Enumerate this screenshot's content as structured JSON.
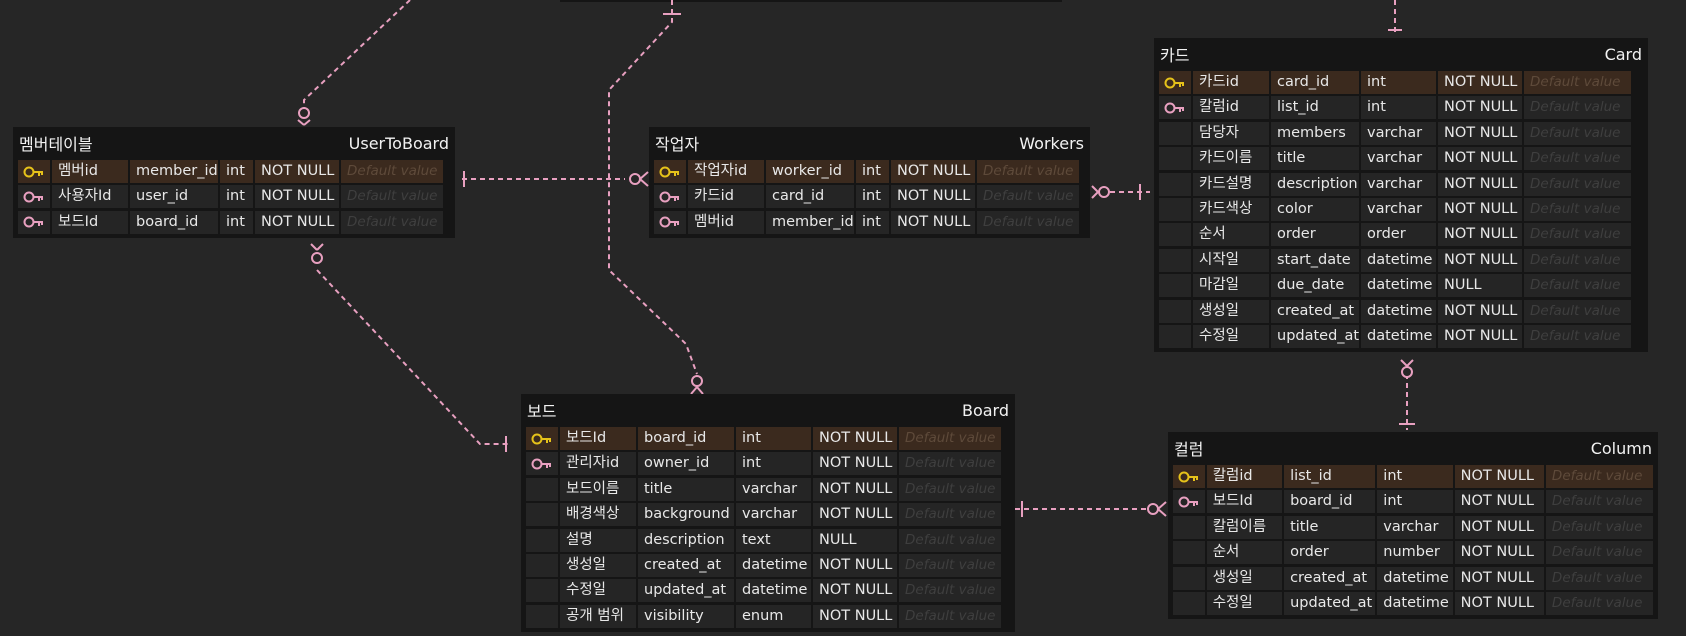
{
  "colors": {
    "background": "#262626",
    "table_bg": "#151515",
    "cell_bg": "#252525",
    "pk_row_bg": "#3b2a1e",
    "relation_line": "#e8a0c0",
    "pk_key": "#e6c21a",
    "fk_key": "#e8a0c0"
  },
  "key_icons": {
    "pk": "primary-key-icon",
    "fk": "foreign-key-icon"
  },
  "tables": [
    {
      "id": "usertoboard",
      "logical_name": "멤버테이블",
      "physical_name": "UserToBoard",
      "columns": [
        {
          "key": "pk",
          "logical": "멤버id",
          "physical": "member_id",
          "type": "int",
          "nullable": "NOT NULL",
          "default": "Default value"
        },
        {
          "key": "fk",
          "logical": "사용자Id",
          "physical": "user_id",
          "type": "int",
          "nullable": "NOT NULL",
          "default": "Default value"
        },
        {
          "key": "fk",
          "logical": "보드Id",
          "physical": "board_id",
          "type": "int",
          "nullable": "NOT NULL",
          "default": "Default value"
        }
      ]
    },
    {
      "id": "workers",
      "logical_name": "작업자",
      "physical_name": "Workers",
      "columns": [
        {
          "key": "pk",
          "logical": "작업자id",
          "physical": "worker_id",
          "type": "int",
          "nullable": "NOT NULL",
          "default": "Default value"
        },
        {
          "key": "fk",
          "logical": "카드id",
          "physical": "card_id",
          "type": "int",
          "nullable": "NOT NULL",
          "default": "Default value"
        },
        {
          "key": "fk",
          "logical": "멤버id",
          "physical": "member_id",
          "type": "int",
          "nullable": "NOT NULL",
          "default": "Default value"
        }
      ]
    },
    {
      "id": "card",
      "logical_name": "카드",
      "physical_name": "Card",
      "columns": [
        {
          "key": "pk",
          "logical": "카드id",
          "physical": "card_id",
          "type": "int",
          "nullable": "NOT NULL",
          "default": "Default value"
        },
        {
          "key": "fk",
          "logical": "칼럼id",
          "physical": "list_id",
          "type": "int",
          "nullable": "NOT NULL",
          "default": "Default value"
        },
        {
          "key": "",
          "logical": "담당자",
          "physical": "members",
          "type": "varchar",
          "nullable": "NOT NULL",
          "default": "Default value"
        },
        {
          "key": "",
          "logical": "카드이름",
          "physical": "title",
          "type": "varchar",
          "nullable": "NOT NULL",
          "default": "Default value"
        },
        {
          "key": "",
          "logical": "카드설명",
          "physical": "description",
          "type": "varchar",
          "nullable": "NOT NULL",
          "default": "Default value"
        },
        {
          "key": "",
          "logical": "카드색상",
          "physical": "color",
          "type": "varchar",
          "nullable": "NOT NULL",
          "default": "Default value"
        },
        {
          "key": "",
          "logical": "순서",
          "physical": "order",
          "type": "order",
          "nullable": "NOT NULL",
          "default": "Default value"
        },
        {
          "key": "",
          "logical": "시작일",
          "physical": "start_date",
          "type": "datetime",
          "nullable": "NOT NULL",
          "default": "Default value"
        },
        {
          "key": "",
          "logical": "마감일",
          "physical": "due_date",
          "type": "datetime",
          "nullable": "NULL",
          "default": "Default value"
        },
        {
          "key": "",
          "logical": "생성일",
          "physical": "created_at",
          "type": "datetime",
          "nullable": "NOT NULL",
          "default": "Default value"
        },
        {
          "key": "",
          "logical": "수정일",
          "physical": "updated_at",
          "type": "datetime",
          "nullable": "NOT NULL",
          "default": "Default value"
        }
      ]
    },
    {
      "id": "board",
      "logical_name": "보드",
      "physical_name": "Board",
      "columns": [
        {
          "key": "pk",
          "logical": "보드Id",
          "physical": "board_id",
          "type": "int",
          "nullable": "NOT NULL",
          "default": "Default value"
        },
        {
          "key": "fk",
          "logical": "관리자id",
          "physical": "owner_id",
          "type": "int",
          "nullable": "NOT NULL",
          "default": "Default value"
        },
        {
          "key": "",
          "logical": "보드이름",
          "physical": "title",
          "type": "varchar",
          "nullable": "NOT NULL",
          "default": "Default value"
        },
        {
          "key": "",
          "logical": "배경색상",
          "physical": "background",
          "type": "varchar",
          "nullable": "NOT NULL",
          "default": "Default value"
        },
        {
          "key": "",
          "logical": "설명",
          "physical": "description",
          "type": "text",
          "nullable": "NULL",
          "default": "Default value"
        },
        {
          "key": "",
          "logical": "생성일",
          "physical": "created_at",
          "type": "datetime",
          "nullable": "NOT NULL",
          "default": "Default value"
        },
        {
          "key": "",
          "logical": "수정일",
          "physical": "updated_at",
          "type": "datetime",
          "nullable": "NOT NULL",
          "default": "Default value"
        },
        {
          "key": "",
          "logical": "공개 범위",
          "physical": "visibility",
          "type": "enum",
          "nullable": "NOT NULL",
          "default": "Default value"
        }
      ]
    },
    {
      "id": "column",
      "logical_name": "컬럼",
      "physical_name": "Column",
      "columns": [
        {
          "key": "pk",
          "logical": "칼럼id",
          "physical": "list_id",
          "type": "int",
          "nullable": "NOT NULL",
          "default": "Default value"
        },
        {
          "key": "fk",
          "logical": "보드Id",
          "physical": "board_id",
          "type": "int",
          "nullable": "NOT NULL",
          "default": "Default value"
        },
        {
          "key": "",
          "logical": "칼럼이름",
          "physical": "title",
          "type": "varchar",
          "nullable": "NOT NULL",
          "default": "Default value"
        },
        {
          "key": "",
          "logical": "순서",
          "physical": "order",
          "type": "number",
          "nullable": "NOT NULL",
          "default": "Default value"
        },
        {
          "key": "",
          "logical": "생성일",
          "physical": "created_at",
          "type": "datetime",
          "nullable": "NOT NULL",
          "default": "Default value"
        },
        {
          "key": "",
          "logical": "수정일",
          "physical": "updated_at",
          "type": "datetime",
          "nullable": "NOT NULL",
          "default": "Default value"
        }
      ]
    }
  ],
  "relations": [
    {
      "id": "usertoboard-workers",
      "from": "UserToBoard",
      "to": "Workers",
      "from_end": "one",
      "to_end": "zero-or-many"
    },
    {
      "id": "board-usertoboard",
      "from": "Board",
      "to": "UserToBoard",
      "from_end": "one",
      "to_end": "zero-or-many"
    },
    {
      "id": "top-board",
      "from": "(offscreen)",
      "to": "Board",
      "from_end": "one",
      "to_end": "zero-or-many"
    },
    {
      "id": "card-workers",
      "from": "Card",
      "to": "Workers",
      "from_end": "one",
      "to_end": "zero-or-many"
    },
    {
      "id": "board-column",
      "from": "Board",
      "to": "Column",
      "from_end": "one",
      "to_end": "zero-or-many"
    },
    {
      "id": "column-card",
      "from": "Column",
      "to": "Card",
      "from_end": "one",
      "to_end": "zero-or-many"
    },
    {
      "id": "top-usertoboard",
      "from": "(offscreen)",
      "to": "UserToBoard",
      "from_end": "one",
      "to_end": "zero-or-many"
    },
    {
      "id": "top-card",
      "from": "(offscreen)",
      "to": "Card",
      "from_end": "one",
      "to_end": "one"
    }
  ]
}
